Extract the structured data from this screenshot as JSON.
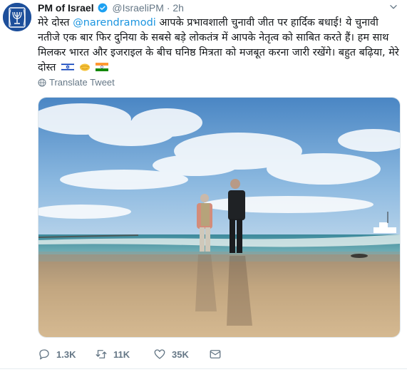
{
  "tweet": {
    "author_name": "PM of Israel",
    "handle": "@IsraeliPM",
    "separator": "·",
    "time": "2h",
    "text_before": "मेरे दोस्त ",
    "mention": "@narendramodi",
    "text_after": " आपके प्रभावशाली चुनावी जीत पर हार्दिक बधाई! ये चुनावी नतीजे एक बार फिर दुनिया के सबसे बड़े लोकतंत्र में आपके नेतृत्व को साबित करते हैं।  हम साथ मिलकर भारत और इजराइल के बीच घनिष्ठ मित्रता को मजबूत करना जारी रखेंगे। बहुत बढ़िया, मेरे दोस्त ",
    "translate_label": "Translate Tweet",
    "media_description": "",
    "actions": {
      "replies": "1.3K",
      "retweets": "11K",
      "likes": "35K",
      "dm": ""
    }
  },
  "colors": {
    "link": "#1b95e0",
    "muted": "#657786",
    "verified": "#1da1f2",
    "avatar_bg": "#1d4f9b"
  },
  "icons": [
    "verified-badge-icon",
    "chevron-down-icon",
    "globe-icon",
    "israel-flag-icon",
    "handshake-icon",
    "india-flag-icon",
    "reply-icon",
    "retweet-icon",
    "like-icon",
    "direct-message-icon"
  ]
}
